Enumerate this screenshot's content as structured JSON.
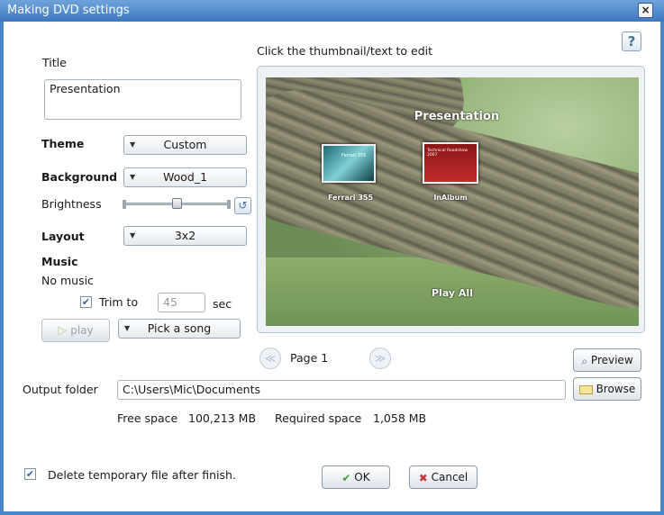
{
  "window": {
    "title": "Making DVD settings",
    "close_glyph": "×"
  },
  "help": {
    "glyph": "?"
  },
  "title_section": {
    "label": "Title",
    "value": "Presentation"
  },
  "theme": {
    "label": "Theme",
    "value": "Custom"
  },
  "background": {
    "label": "Background",
    "value": "Wood_1"
  },
  "brightness": {
    "label": "Brightness",
    "level": 0.5
  },
  "layout": {
    "label": "Layout",
    "value": "3x2"
  },
  "music": {
    "label": "Music",
    "status": "No music",
    "trim_label": "Trim to",
    "trim_checked": true,
    "trim_value": "45",
    "trim_unit": "sec",
    "play_label": "play",
    "pick_label": "Pick a song"
  },
  "preview": {
    "instruction": "Click the thumbnail/text to edit",
    "menu_title": "Presentation",
    "thumb1_caption": "Ferrari 355",
    "thumb1_text": "Ferrari 355",
    "thumb2_caption": "InAlbum",
    "thumb2_text": "Technical Roadshow 2007",
    "play_all": "Play All",
    "page_label": "Page 1",
    "preview_button": "Preview"
  },
  "output": {
    "label": "Output folder",
    "path": "C:\\Users\\Mic\\Documents",
    "browse_label": "Browse",
    "free_label": "Free space",
    "free_value": "100,213 MB",
    "required_label": "Required space",
    "required_value": "1,058 MB"
  },
  "footer": {
    "delete_label": "Delete temporary file after finish.",
    "delete_checked": true,
    "ok_label": "OK",
    "cancel_label": "Cancel"
  },
  "colors": {
    "title_bar": "#3d78bf",
    "accent": "#4a86c8"
  }
}
